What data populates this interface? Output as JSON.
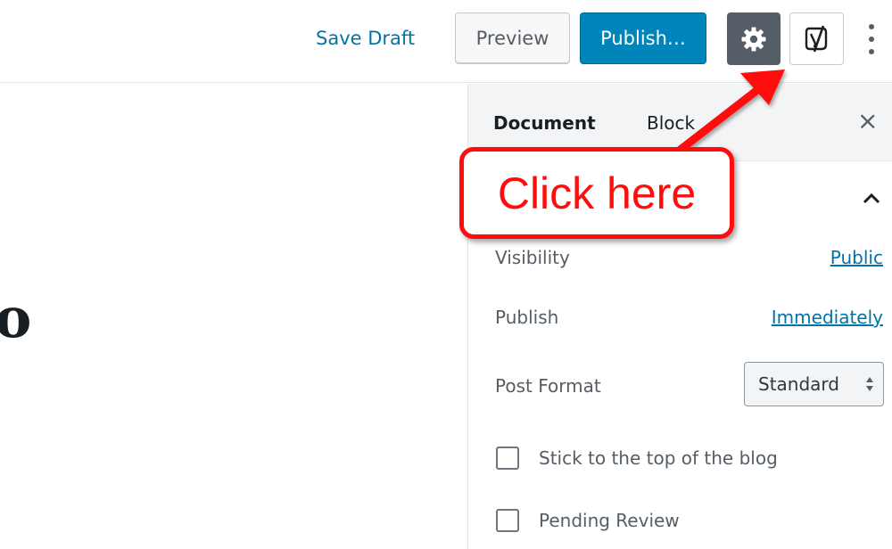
{
  "header": {
    "save_draft_label": "Save Draft",
    "preview_label": "Preview",
    "publish_label": "Publish…"
  },
  "editor": {
    "title_fragment": "o"
  },
  "sidebar": {
    "tabs": [
      {
        "label": "Document"
      },
      {
        "label": "Block"
      }
    ],
    "close_symbol": "×",
    "rows": {
      "visibility_label": "Visibility",
      "visibility_value": "Public",
      "publish_label": "Publish",
      "publish_value": "Immediately",
      "post_format_label": "Post Format",
      "post_format_value": "Standard"
    },
    "checkboxes": [
      {
        "label": "Stick to the top of the blog",
        "checked": false
      },
      {
        "label": "Pending Review",
        "checked": false
      }
    ]
  },
  "annotation": {
    "callout_text": "Click here",
    "color": "#ff0d0d"
  },
  "colors": {
    "primary_blue": "#0085ba",
    "link_blue": "#0073aa",
    "settings_dark": "#555d66"
  },
  "icons": [
    "gear-icon",
    "yoast-icon",
    "more-vertical-icon",
    "close-icon",
    "chevron-up-icon",
    "select-arrows-icon",
    "arrow-annotation-icon"
  ]
}
